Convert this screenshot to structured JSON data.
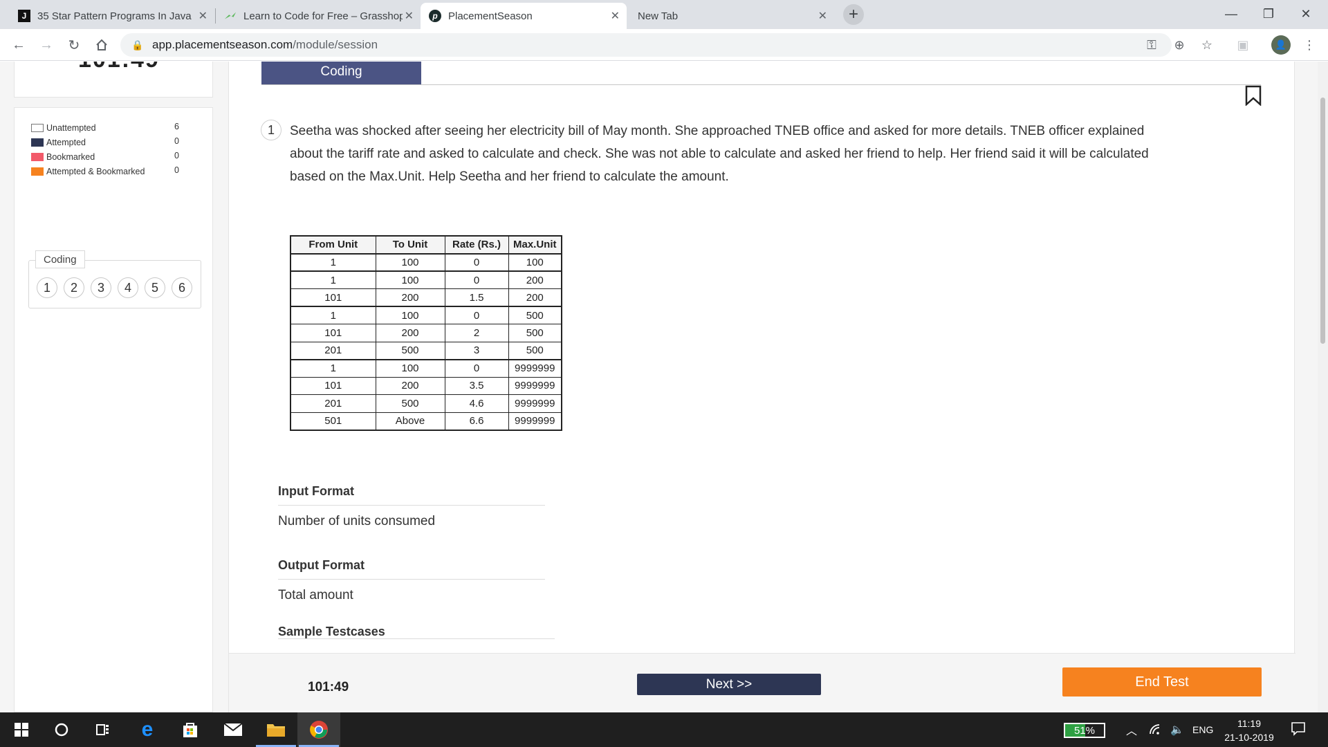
{
  "browser": {
    "tabs": [
      {
        "title": "35 Star Pattern Programs In Java",
        "favicon": "J",
        "icon": "java-j-icon",
        "active": false
      },
      {
        "title": "Learn to Code for Free – Grasshopper",
        "favicon": "",
        "icon": "grasshopper-icon",
        "active": false
      },
      {
        "title": "PlacementSeason",
        "favicon": "p",
        "icon": "placementseason-icon",
        "active": true
      },
      {
        "title": "New Tab",
        "favicon": "",
        "icon": "",
        "active": false
      }
    ],
    "url_host": "app.placementseason.com",
    "url_path": "/module/session"
  },
  "sidebar": {
    "legend": [
      {
        "label": "Unattempted",
        "count": "6",
        "color": "#ffffff"
      },
      {
        "label": "Attempted",
        "count": "0",
        "color": "#2d3654"
      },
      {
        "label": "Bookmarked",
        "count": "0",
        "color": "#f25a6a"
      },
      {
        "label": "Attempted & Bookmarked",
        "count": "0",
        "color": "#f6821f"
      }
    ],
    "section_label": "Coding",
    "question_numbers": [
      "1",
      "2",
      "3",
      "4",
      "5",
      "6"
    ]
  },
  "main": {
    "section_title": "Coding",
    "question_number": "1",
    "question_text": "Seetha was shocked after seeing her electricity bill of May month. She approached TNEB office and asked for more details. TNEB officer explained about the tariff rate and asked to calculate and check. She was not able to calculate and asked her friend to help. Her friend said it will be calculated based on the Max.Unit. Help Seetha and her friend to calculate the amount.",
    "table": {
      "headers": [
        "From Unit",
        "To Unit",
        "Rate (Rs.)",
        "Max.Unit"
      ],
      "rows": [
        [
          "1",
          "100",
          "0",
          "100"
        ],
        [
          "1",
          "100",
          "0",
          "200"
        ],
        [
          "101",
          "200",
          "1.5",
          "200"
        ],
        [
          "1",
          "100",
          "0",
          "500"
        ],
        [
          "101",
          "200",
          "2",
          "500"
        ],
        [
          "201",
          "500",
          "3",
          "500"
        ],
        [
          "1",
          "100",
          "0",
          "9999999"
        ],
        [
          "101",
          "200",
          "3.5",
          "9999999"
        ],
        [
          "201",
          "500",
          "4.6",
          "9999999"
        ],
        [
          "501",
          "Above",
          "6.6",
          "9999999"
        ]
      ]
    },
    "input_format_heading": "Input Format",
    "input_format_body": "Number of units consumed",
    "output_format_heading": "Output Format",
    "output_format_body": "Total amount",
    "sample_heading": "Sample Testcases"
  },
  "footer": {
    "timer": "101:49",
    "next_label": "Next >>",
    "end_label": "End Test"
  },
  "taskbar": {
    "battery": "51%",
    "battery_level": 0.51,
    "language": "ENG",
    "time": "11:19",
    "date": "21-10-2019"
  }
}
